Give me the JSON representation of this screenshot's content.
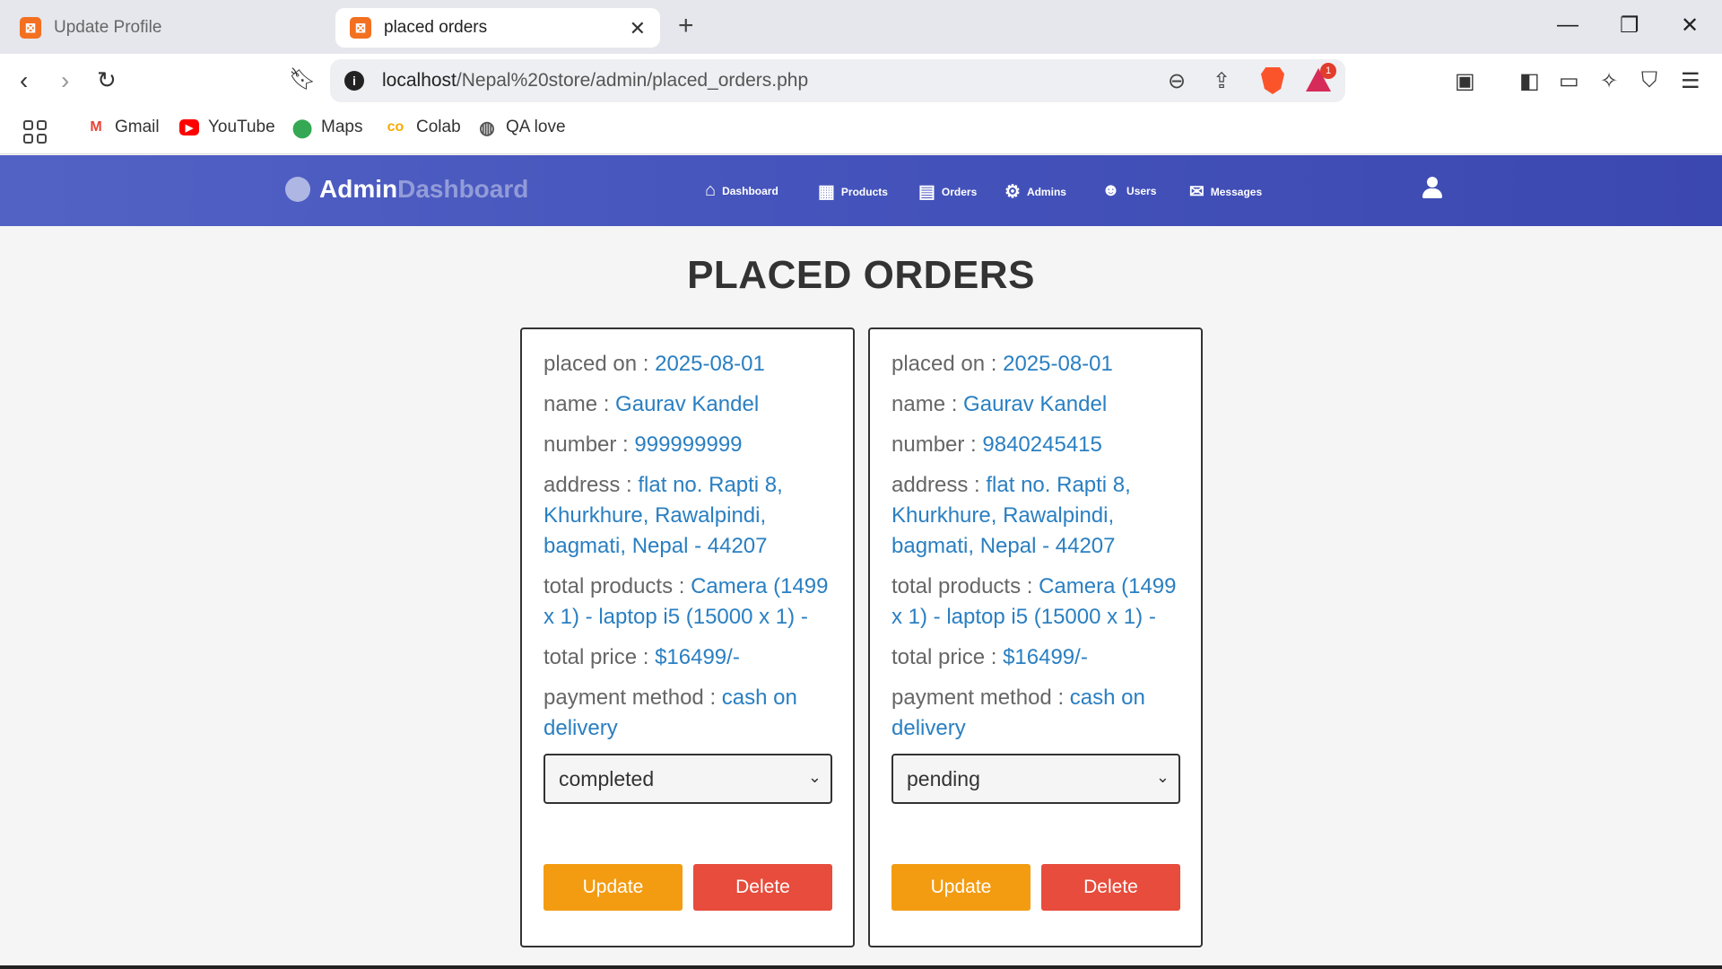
{
  "browser": {
    "tabs": [
      {
        "title": "Update Profile",
        "active": false
      },
      {
        "title": "placed orders",
        "active": true
      }
    ],
    "url_host": "localhost",
    "url_path": "/Nepal%20store/admin/placed_orders.php",
    "rewards_badge": "1",
    "bookmarks": [
      {
        "label": "Gmail",
        "icon": "gmail-icon"
      },
      {
        "label": "YouTube",
        "icon": "youtube-icon"
      },
      {
        "label": "Maps",
        "icon": "maps-icon"
      },
      {
        "label": "Colab",
        "icon": "colab-icon"
      },
      {
        "label": "QA love",
        "icon": "globe-icon"
      }
    ]
  },
  "header": {
    "logo_admin": "Admin",
    "logo_dashboard": "Dashboard",
    "nav": [
      {
        "label": "Dashboard",
        "icon": "home-icon"
      },
      {
        "label": "Products",
        "icon": "boxes-icon"
      },
      {
        "label": "Orders",
        "icon": "clipboard-icon"
      },
      {
        "label": "Admins",
        "icon": "user-gear-icon"
      },
      {
        "label": "Users",
        "icon": "users-icon"
      },
      {
        "label": "Messages",
        "icon": "envelope-icon"
      }
    ]
  },
  "page": {
    "title": "PLACED ORDERS"
  },
  "labels": {
    "placed_on": "placed on : ",
    "name": "name : ",
    "number": "number : ",
    "address": "address : ",
    "total_products": "total products : ",
    "total_price": "total price : ",
    "payment_method": "payment method : ",
    "update": "Update",
    "delete": "Delete"
  },
  "orders": [
    {
      "placed_on": "2025-08-01",
      "name": "Gaurav Kandel",
      "number": "999999999",
      "address": "flat no. Rapti 8, Khurkhure, Rawalpindi, bagmati, Nepal - 44207",
      "total_products": "Camera (1499 x 1) - laptop i5 (15000 x 1) -",
      "total_price": "$16499/-",
      "payment_method": "cash on delivery",
      "status": "completed"
    },
    {
      "placed_on": "2025-08-01",
      "name": "Gaurav Kandel",
      "number": "9840245415",
      "address": "flat no. Rapti 8, Khurkhure, Rawalpindi, bagmati, Nepal - 44207",
      "total_products": "Camera (1499 x 1) - laptop i5 (15000 x 1) -",
      "total_price": "$16499/-",
      "payment_method": "cash on delivery",
      "status": "pending"
    }
  ],
  "colors": {
    "header_gradient_start": "#5262c4",
    "header_gradient_end": "#3b48b0",
    "value_text": "#2a7fc1",
    "update_button": "#f39c12",
    "delete_button": "#e74c3c"
  }
}
